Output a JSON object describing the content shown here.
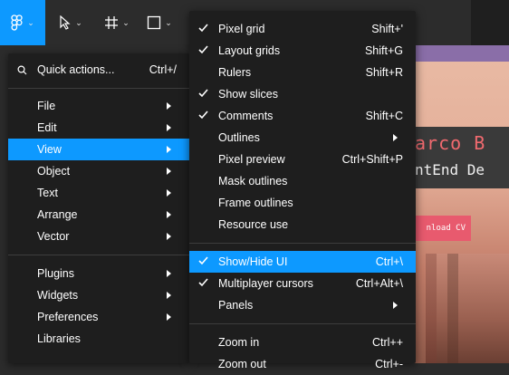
{
  "main_menu": {
    "quick_actions": {
      "label": "Quick actions...",
      "shortcut": "Ctrl+/"
    },
    "groups": [
      [
        {
          "label": "File"
        },
        {
          "label": "Edit"
        },
        {
          "label": "View",
          "highlighted": true
        },
        {
          "label": "Object"
        },
        {
          "label": "Text"
        },
        {
          "label": "Arrange"
        },
        {
          "label": "Vector"
        }
      ],
      [
        {
          "label": "Plugins"
        },
        {
          "label": "Widgets"
        },
        {
          "label": "Preferences"
        },
        {
          "label": "Libraries"
        }
      ]
    ]
  },
  "view_submenu": {
    "groups": [
      [
        {
          "label": "Pixel grid",
          "shortcut": "Shift+'",
          "checked": true
        },
        {
          "label": "Layout grids",
          "shortcut": "Shift+G",
          "checked": true
        },
        {
          "label": "Rulers",
          "shortcut": "Shift+R",
          "checked": false
        },
        {
          "label": "Show slices",
          "shortcut": "",
          "checked": true
        },
        {
          "label": "Comments",
          "shortcut": "Shift+C",
          "checked": true
        },
        {
          "label": "Outlines",
          "shortcut": "",
          "submenu": true
        },
        {
          "label": "Pixel preview",
          "shortcut": "Ctrl+Shift+P"
        },
        {
          "label": "Mask outlines",
          "shortcut": ""
        },
        {
          "label": "Frame outlines",
          "shortcut": ""
        },
        {
          "label": "Resource use",
          "shortcut": ""
        }
      ],
      [
        {
          "label": "Show/Hide UI",
          "shortcut": "Ctrl+\\",
          "checked": true,
          "highlighted": true
        },
        {
          "label": "Multiplayer cursors",
          "shortcut": "Ctrl+Alt+\\",
          "checked": true
        },
        {
          "label": "Panels",
          "shortcut": "",
          "submenu": true
        }
      ],
      [
        {
          "label": "Zoom in",
          "shortcut": "Ctrl++"
        },
        {
          "label": "Zoom out",
          "shortcut": "Ctrl+-"
        }
      ]
    ]
  },
  "canvas_frame": {
    "name_text": "arco B",
    "role_text": "ntEnd De",
    "cv_button": "nload CV"
  },
  "colors": {
    "accent": "#0d99ff",
    "menu_bg": "#1e1e1e",
    "toolbar_bg": "#2c2c2c"
  }
}
